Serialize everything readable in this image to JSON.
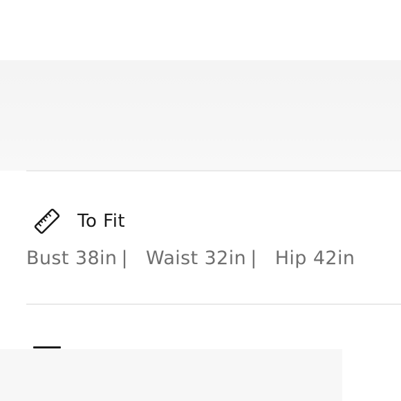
{
  "section": {
    "title": "To Fit",
    "icon": "ruler-icon"
  },
  "measurements": {
    "bust": "Bust 38in",
    "waist": "Waist 32in",
    "hip": "Hip 42in",
    "separator": "|"
  },
  "colors": {
    "title": "#1a1a1a",
    "measurement_text": "#6f6f6f",
    "divider": "#e9e9e9",
    "banner": "#f5f5f5"
  }
}
